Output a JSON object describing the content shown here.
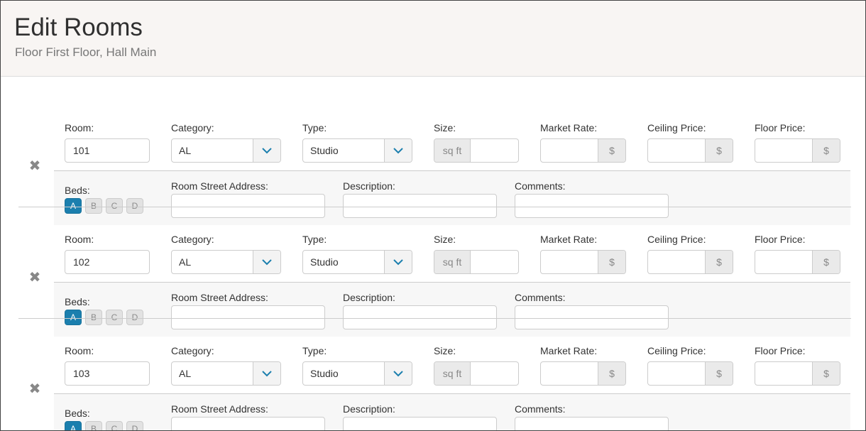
{
  "header": {
    "title": "Edit Rooms",
    "subtitle": "Floor First Floor, Hall Main"
  },
  "labels": {
    "room": "Room:",
    "category": "Category:",
    "type": "Type:",
    "size": "Size:",
    "market_rate": "Market Rate:",
    "ceiling_price": "Ceiling Price:",
    "floor_price": "Floor Price:",
    "beds": "Beds:",
    "street_address": "Room Street Address:",
    "description": "Description:",
    "comments": "Comments:",
    "size_unit": "sq ft",
    "currency": "$",
    "delete_icon": "✖"
  },
  "rooms": [
    {
      "room": "101",
      "category": "AL",
      "type": "Studio",
      "size": "",
      "market_rate": "",
      "ceiling_price": "",
      "floor_price": "",
      "street_address": "",
      "description": "",
      "comments": "",
      "beds": [
        {
          "label": "A",
          "active": true
        },
        {
          "label": "B",
          "active": false
        },
        {
          "label": "C",
          "active": false
        },
        {
          "label": "D",
          "active": false
        }
      ]
    },
    {
      "room": "102",
      "category": "AL",
      "type": "Studio",
      "size": "",
      "market_rate": "",
      "ceiling_price": "",
      "floor_price": "",
      "street_address": "",
      "description": "",
      "comments": "",
      "beds": [
        {
          "label": "A",
          "active": true
        },
        {
          "label": "B",
          "active": false
        },
        {
          "label": "C",
          "active": false
        },
        {
          "label": "D",
          "active": false
        }
      ]
    },
    {
      "room": "103",
      "category": "AL",
      "type": "Studio",
      "size": "",
      "market_rate": "",
      "ceiling_price": "",
      "floor_price": "",
      "street_address": "",
      "description": "",
      "comments": "",
      "beds": [
        {
          "label": "A",
          "active": true
        },
        {
          "label": "B",
          "active": false
        },
        {
          "label": "C",
          "active": false
        },
        {
          "label": "D",
          "active": false
        }
      ]
    }
  ],
  "colors": {
    "accent": "#1b7fae",
    "header_bg": "#f8f5f3",
    "sub_row_bg": "#f7f7f7"
  },
  "icons": {
    "delete": "close-icon",
    "select_caret": "chevron-down-icon"
  }
}
